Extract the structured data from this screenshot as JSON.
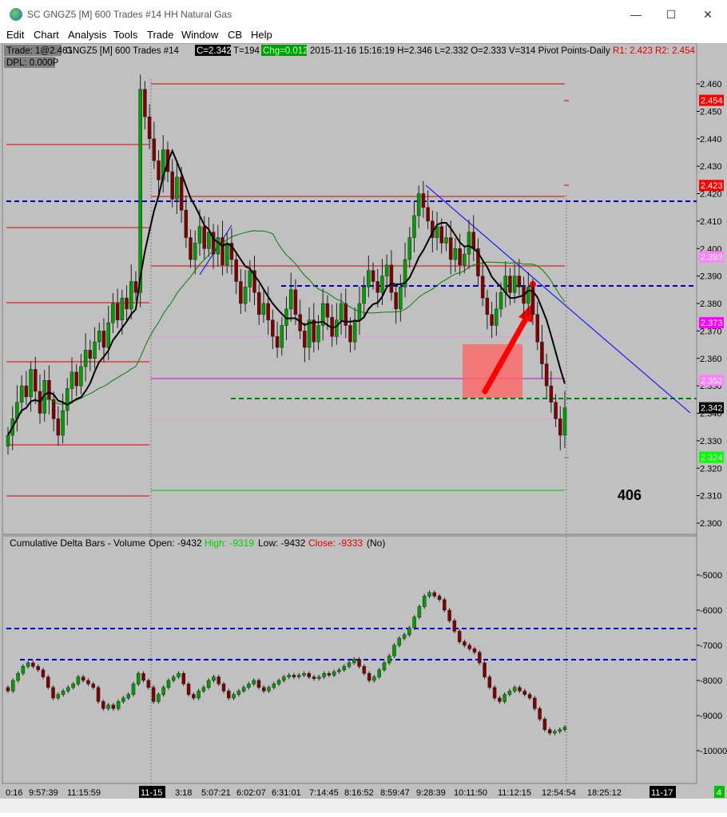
{
  "window": {
    "title": "SC GNGZ5 [M]  600 Trades  #14  HH Natural Gas",
    "minimize": "—",
    "maximize": "☐",
    "close": "✕"
  },
  "menu": [
    "Edit",
    "Chart",
    "Analysis",
    "Tools",
    "Trade",
    "Window",
    "CB",
    "Help"
  ],
  "header": {
    "trade_label": "Trade: 1@2.461",
    "symbol": "GNGZ5 [M]  600 Trades  #14",
    "close_label": "C=2.342",
    "trades_label": "T=194",
    "change_label": "Chg=0.012",
    "info_label": "2015-11-16  15:16:19  H=2.346  L=2.332  O=2.333  V=314  Pivot Points-Daily",
    "r1_label": "R1: 2.423",
    "r2_label": "R2: 2.454",
    "dpl_label": "DPL: 0.000P"
  },
  "annotation": {
    "text": "406"
  },
  "chart_data": [
    {
      "type": "candlestick",
      "name": "GNGZ5 600 Trades",
      "ylim": [
        2.295,
        2.465
      ],
      "yticks": [
        "2.460",
        "2.450",
        "2.440",
        "2.430",
        "2.420",
        "2.410",
        "2.400",
        "2.390",
        "2.380",
        "2.370",
        "2.360",
        "2.350",
        "2.340",
        "2.330",
        "2.320",
        "2.310",
        "2.300"
      ],
      "price_tags": [
        {
          "label": "2.454",
          "value": 2.454,
          "bg": "#ff0000",
          "fg": "#ffffff"
        },
        {
          "label": "2.423",
          "value": 2.423,
          "bg": "#ff0000",
          "fg": "#ffffff"
        },
        {
          "label": "2.393",
          "value": 2.397,
          "bg": "#ff80ff",
          "fg": "#ffffff"
        },
        {
          "label": "2.373",
          "value": 2.373,
          "bg": "#ff00ff",
          "fg": "#ffffff"
        },
        {
          "label": "2.352",
          "value": 2.352,
          "bg": "#ff80ff",
          "fg": "#ffffff"
        },
        {
          "label": "2.342",
          "value": 2.342,
          "bg": "#000000",
          "fg": "#ffffff"
        },
        {
          "label": "2.324",
          "value": 2.324,
          "bg": "#00ff00",
          "fg": "#ffffff"
        }
      ],
      "closes": [
        2.332,
        2.338,
        2.344,
        2.35,
        2.346,
        2.356,
        2.348,
        2.34,
        2.352,
        2.345,
        2.338,
        2.332,
        2.341,
        2.349,
        2.355,
        2.35,
        2.357,
        2.363,
        2.36,
        2.366,
        2.37,
        2.364,
        2.373,
        2.38,
        2.374,
        2.382,
        2.378,
        2.388,
        2.384,
        2.458,
        2.448,
        2.44,
        2.432,
        2.425,
        2.436,
        2.428,
        2.418,
        2.426,
        2.414,
        2.404,
        2.396,
        2.402,
        2.408,
        2.4,
        2.406,
        2.398,
        2.404,
        2.394,
        2.402,
        2.396,
        2.388,
        2.38,
        2.386,
        2.392,
        2.384,
        2.376,
        2.38,
        2.374,
        2.368,
        2.364,
        2.372,
        2.378,
        2.385,
        2.376,
        2.37,
        2.364,
        2.374,
        2.366,
        2.372,
        2.38,
        2.375,
        2.368,
        2.374,
        2.38,
        2.372,
        2.366,
        2.374,
        2.38,
        2.386,
        2.392,
        2.388,
        2.384,
        2.39,
        2.394,
        2.384,
        2.378,
        2.386,
        2.396,
        2.404,
        2.412,
        2.42,
        2.415,
        2.41,
        2.404,
        2.408,
        2.402,
        2.404,
        2.396,
        2.4,
        2.394,
        2.398,
        2.406,
        2.4,
        2.39,
        2.382,
        2.376,
        2.372,
        2.378,
        2.384,
        2.39,
        2.384,
        2.39,
        2.386,
        2.38,
        2.386,
        2.376,
        2.366,
        2.358,
        2.35,
        2.344,
        2.338,
        2.332,
        2.342
      ],
      "lines": [
        {
          "name": "R2",
          "y": 2.46,
          "from": "11-15",
          "color": "#e00000"
        },
        {
          "name": "R1",
          "y": 2.419,
          "from": "11-15",
          "color": "#e00000"
        },
        {
          "name": "P",
          "y": 2.394,
          "from": "11-15",
          "color": "#e00000"
        },
        {
          "name": "VWAP band",
          "y": 2.3535,
          "from": "11-15",
          "color": "#e000e0"
        },
        {
          "name": "S",
          "y": 2.312,
          "from": "11-15",
          "color": "#00b000"
        }
      ]
    },
    {
      "type": "bar",
      "name": "Cumulative Delta Bars - Volume",
      "title": "Cumulative Delta Bars - Volume",
      "open_label": "Open: -9432",
      "high_label": "High: -9319",
      "low_label": "Low: -9432",
      "close_label": "Close: -9333",
      "no_label": "(No)",
      "ylim": [
        -10300,
        -4700
      ],
      "yticks": [
        "-5000",
        "-6000",
        "-7000",
        "-8000",
        "-9000",
        "-10000"
      ],
      "values": [
        -8300,
        -8000,
        -7800,
        -7600,
        -7500,
        -7600,
        -7700,
        -7900,
        -8200,
        -8500,
        -8400,
        -8300,
        -8200,
        -8100,
        -7900,
        -8000,
        -8100,
        -8200,
        -8600,
        -8800,
        -8700,
        -8800,
        -8600,
        -8500,
        -8400,
        -8100,
        -7800,
        -8000,
        -8200,
        -8600,
        -8400,
        -8200,
        -8000,
        -7900,
        -7800,
        -8100,
        -8400,
        -8500,
        -8300,
        -8200,
        -8000,
        -7900,
        -8100,
        -8300,
        -8500,
        -8400,
        -8300,
        -8200,
        -8100,
        -8000,
        -8200,
        -8300,
        -8200,
        -8100,
        -8000,
        -7900,
        -7850,
        -7900,
        -7850,
        -7800,
        -7900,
        -7950,
        -7900,
        -7800,
        -7850,
        -7750,
        -7700,
        -7600,
        -7500,
        -7400,
        -7600,
        -7800,
        -8000,
        -7900,
        -7700,
        -7500,
        -7300,
        -7000,
        -6800,
        -6700,
        -6500,
        -6200,
        -5900,
        -5600,
        -5500,
        -5600,
        -5700,
        -6000,
        -6300,
        -6600,
        -6900,
        -7000,
        -7100,
        -7200,
        -7500,
        -7900,
        -8200,
        -8500,
        -8600,
        -8400,
        -8300,
        -8200,
        -8300,
        -8400,
        -8500,
        -8800,
        -9100,
        -9400,
        -9500,
        -9450,
        -9400,
        -9333
      ],
      "hlines": [
        -6500,
        -7350
      ]
    }
  ],
  "xaxis": {
    "labels": [
      "0:16",
      "9:57:39",
      "11:15:59",
      "11-15",
      "3:18",
      "5:07:21",
      "6:02:07",
      "6:31:01",
      "7:14:45",
      "8:16:52",
      "8:59:47",
      "9:28:39",
      "10:11:50",
      "11:12:15",
      "12:54:54",
      "18:25:12",
      "11-17"
    ],
    "highlighted": [
      "11-15",
      "11-17"
    ],
    "corner_label": "4"
  },
  "colors": {
    "chart_bg": "#c0c0c0",
    "up_candle": "#00a000",
    "down_candle": "#800000",
    "resistance": "#e00000",
    "pivot_blue": "#0000cc",
    "magenta": "#ff66ff",
    "green_dash": "#008000",
    "arrow": "#ff0000"
  }
}
